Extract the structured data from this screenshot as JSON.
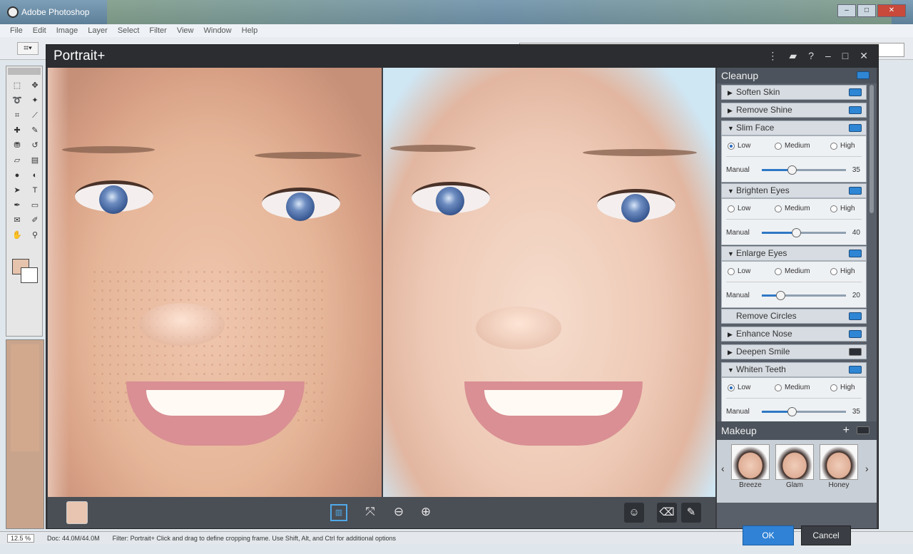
{
  "photoshop": {
    "title": "Adobe Photoshop",
    "menu": [
      "File",
      "Edit",
      "Image",
      "Layer",
      "Select",
      "Filter",
      "View",
      "Window",
      "Help"
    ],
    "status": {
      "zoom": "12.5 %",
      "doc": "Doc: 44.0M/44.0M",
      "hint": "Filter: Portrait+  Click and drag to define cropping frame. Use Shift, Alt, and Ctrl for additional options"
    }
  },
  "dialog": {
    "title": "Portrait+",
    "cleanup": {
      "header": "Cleanup",
      "items": {
        "soften_skin": "Soften Skin",
        "remove_shine": "Remove Shine",
        "slim_face": "Slim Face",
        "brighten_eyes": "Brighten Eyes",
        "enlarge_eyes": "Enlarge Eyes",
        "remove_circles": "Remove Circles",
        "enhance_nose": "Enhance Nose",
        "deepen_smile": "Deepen Smile",
        "whiten_teeth": "Whiten Teeth"
      },
      "radio_low": "Low",
      "radio_medium": "Medium",
      "radio_high": "High",
      "manual_label": "Manual",
      "slim_face_value": "35",
      "brighten_eyes_value": "40",
      "enlarge_eyes_value": "20",
      "whiten_teeth_value": "35"
    },
    "makeup": {
      "header": "Makeup",
      "add": "+",
      "presets": [
        "Breeze",
        "Glam",
        "Honey"
      ]
    },
    "buttons": {
      "ok": "OK",
      "cancel": "Cancel"
    },
    "accent_color": "#2f82d6"
  }
}
